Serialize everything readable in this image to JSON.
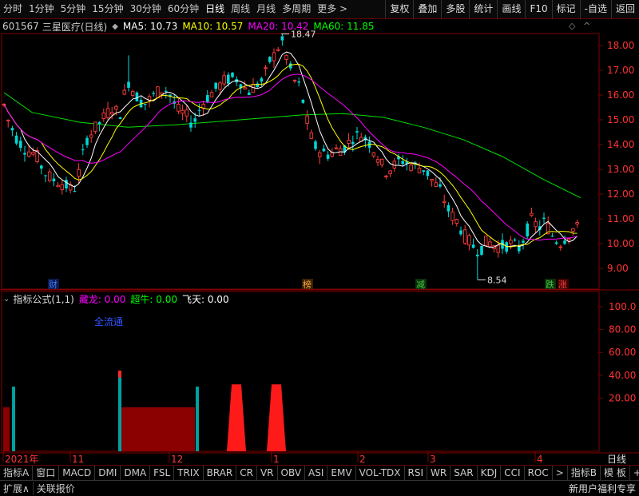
{
  "period_tabs": [
    "分时",
    "1分钟",
    "5分钟",
    "15分钟",
    "30分钟",
    "60分钟",
    "日线",
    "周线",
    "月线",
    "多周期",
    "更多 >"
  ],
  "active_period": "日线",
  "toolbar": [
    "复权",
    "叠加",
    "多股",
    "统计",
    "画线",
    "F10",
    "标记",
    "-自选",
    "返回"
  ],
  "stock": {
    "code": "601567",
    "name": "三星医疗",
    "period": "(日线)"
  },
  "ma": [
    {
      "label": "MA5: 10.73",
      "color": "#ffffff"
    },
    {
      "label": "MA10: 10.57",
      "color": "#ffff00"
    },
    {
      "label": "MA20: 10.42",
      "color": "#ff00ff"
    },
    {
      "label": "MA60: 11.85",
      "color": "#00ff00"
    }
  ],
  "price_axis": [
    "18.00",
    "17.00",
    "16.00",
    "15.00",
    "14.00",
    "13.00",
    "12.00",
    "11.00",
    "10.00",
    "9.00"
  ],
  "high_label": "18.47",
  "low_label": "8.54",
  "markers": [
    {
      "text": "财",
      "color": "#4477ff",
      "bg": "#0a1a4a"
    },
    {
      "text": "榜",
      "color": "#ffaa44",
      "bg": "#3a2000"
    },
    {
      "text": "减",
      "color": "#44cc44",
      "bg": "#0a300a"
    },
    {
      "text": "跌",
      "color": "#44cc44",
      "bg": "#0a300a"
    },
    {
      "text": "涨",
      "color": "#ff4444",
      "bg": "#400000"
    }
  ],
  "indicator": {
    "name": "指标公式(1,1)",
    "items": [
      {
        "label": "藏龙: 0.00",
        "color": "#ff00ff"
      },
      {
        "label": "超牛: 0.00",
        "color": "#00ff00"
      },
      {
        "label": "飞天: 0.00",
        "color": "#ffffff"
      }
    ],
    "note": "全流通",
    "axis": [
      "100.0",
      "80.00",
      "60.00",
      "40.00",
      "20.00"
    ]
  },
  "date_axis": [
    "2021年",
    "11",
    "12",
    "1",
    "2",
    "3",
    "4"
  ],
  "date_right": "日线",
  "indicator_tabs": [
    "指标A",
    "窗口",
    "MACD",
    "DMI",
    "DMA",
    "FSL",
    "TRIX",
    "BRAR",
    "CR",
    "VR",
    "OBV",
    "ASI",
    "EMV",
    "VOL-TDX",
    "RSI",
    "WR",
    "SAR",
    "KDJ",
    "CCI",
    "ROC",
    ">",
    "指标B",
    "模 板",
    "+",
    "-"
  ],
  "status_bar": {
    "left": [
      "扩展∧",
      "关联报价"
    ],
    "right": "新用户福利专享"
  }
}
